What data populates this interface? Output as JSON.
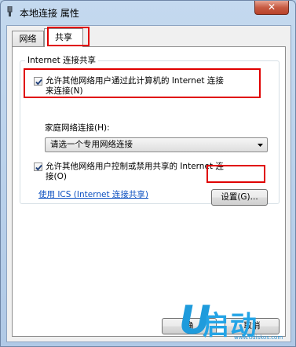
{
  "window": {
    "title": "本地连接 属性",
    "close_label": "✕"
  },
  "tabs": [
    {
      "label": "网络"
    },
    {
      "label": "共享"
    }
  ],
  "sharing": {
    "group_title": "Internet 连接共享",
    "allow_other_users_connect": {
      "checked": true,
      "label_line1": "允许其他网络用户通过此计算机的 Internet 连接",
      "label_line2": "来连接(N)"
    },
    "home_network_label": "家庭网络连接(H):",
    "home_network_dropdown": {
      "selected": "请选一个专用网络连接"
    },
    "allow_other_users_control": {
      "checked": true,
      "label_line1": "允许其他网络用户控制或禁用共享的 Internet 连",
      "label_line2": "接(O)"
    },
    "ics_link": "使用 ICS (Internet 连接共享)",
    "settings_button": "设置(G)..."
  },
  "footer": {
    "ok_button": "确",
    "cancel_button": "取消"
  },
  "watermark": {
    "brand": "启动",
    "url": "www.udiskos.com"
  },
  "colors": {
    "highlight": "#e00000",
    "link": "#0b4fc0",
    "watermark": "#24a4e6"
  }
}
